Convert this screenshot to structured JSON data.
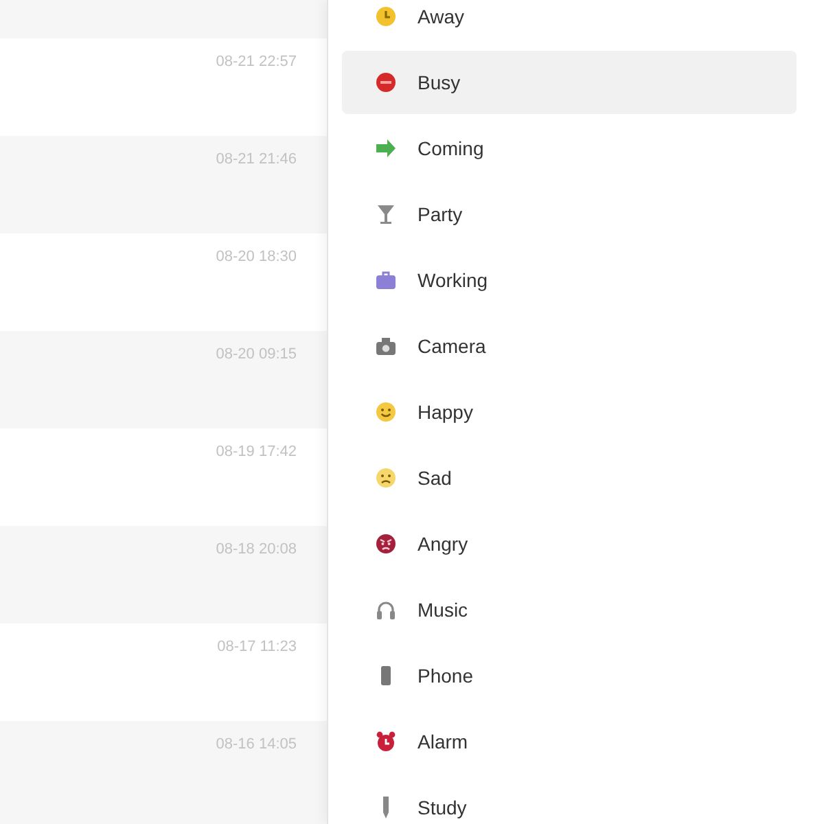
{
  "conversation_list": {
    "rows": [
      {
        "time": "08-21 22:57"
      },
      {
        "time": "08-21 21:46"
      },
      {
        "time": "08-20 18:30"
      },
      {
        "time": "08-20 09:15"
      },
      {
        "time": "08-19 17:42"
      },
      {
        "time": "08-18 20:08"
      },
      {
        "time": "08-17 11:23"
      },
      {
        "time": "08-16 14:05"
      }
    ]
  },
  "status_menu": {
    "items": [
      {
        "label": "Away",
        "selected": false
      },
      {
        "label": "Busy",
        "selected": true
      },
      {
        "label": "Coming",
        "selected": false
      },
      {
        "label": "Party",
        "selected": false
      },
      {
        "label": "Working",
        "selected": false
      },
      {
        "label": "Camera",
        "selected": false
      },
      {
        "label": "Happy",
        "selected": false
      },
      {
        "label": "Sad",
        "selected": false
      },
      {
        "label": "Angry",
        "selected": false
      },
      {
        "label": "Music",
        "selected": false
      },
      {
        "label": "Phone",
        "selected": false
      },
      {
        "label": "Alarm",
        "selected": false
      },
      {
        "label": "Study",
        "selected": false
      }
    ]
  }
}
